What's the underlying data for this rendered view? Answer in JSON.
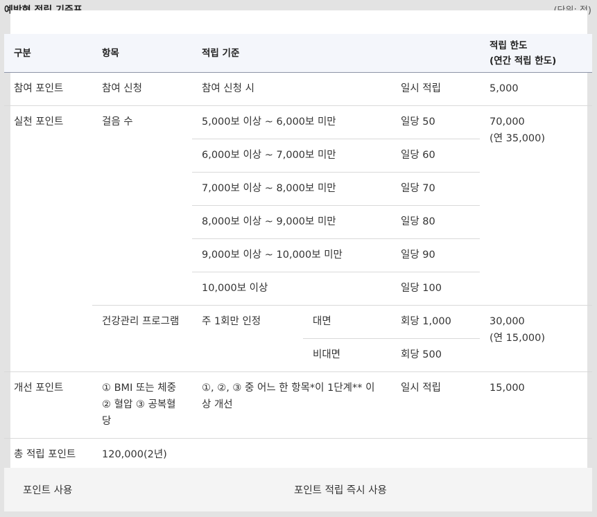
{
  "title": "예방형 적립 기준표",
  "unit": "(단위: 점)",
  "headers": {
    "category": "구분",
    "item": "항목",
    "criteria": "적립 기준",
    "limit_line1": "적립 한도",
    "limit_line2": "(연간 적립 한도)"
  },
  "rows": {
    "participation": {
      "category": "참여 포인트",
      "item": "참여 신청",
      "criteria": "참여 신청 시",
      "points": "일시 적립",
      "limit": "5,000"
    },
    "practice": {
      "category": "실천 포인트",
      "steps_item": "걸음 수",
      "steps": [
        {
          "criteria": "5,000보 이상 ~ 6,000보 미만",
          "points": "일당 50"
        },
        {
          "criteria": "6,000보 이상 ~ 7,000보 미만",
          "points": "일당 60"
        },
        {
          "criteria": "7,000보 이상 ~ 8,000보 미만",
          "points": "일당 70"
        },
        {
          "criteria": "8,000보 이상 ~ 9,000보 미만",
          "points": "일당 80"
        },
        {
          "criteria": "9,000보 이상 ~ 10,000보 미만",
          "points": "일당 90"
        },
        {
          "criteria": "10,000보 이상",
          "points": "일당 100"
        }
      ],
      "steps_limit": "70,000",
      "steps_limit_sub": "(연 35,000)",
      "program_item": "건강관리 프로그램",
      "program_criteria": "주 1회만 인정",
      "program_modes": [
        {
          "mode": "대면",
          "points": "회당 1,000"
        },
        {
          "mode": "비대면",
          "points": "회당 500"
        }
      ],
      "program_limit": "30,000",
      "program_limit_sub": "(연 15,000)"
    },
    "improvement": {
      "category": "개선 포인트",
      "item": "① BMI 또는 체중 ② 혈압 ③ 공복혈당",
      "criteria": "①, ②, ③ 중 어느 한 항목*이 1단계** 이상 개선",
      "points": "일시 적립",
      "limit": "15,000"
    },
    "total": {
      "category": "총 적립 포인트",
      "value": "120,000(2년)"
    }
  },
  "footer": {
    "label": "포인트 사용",
    "value": "포인트 적립 즉시 사용"
  }
}
